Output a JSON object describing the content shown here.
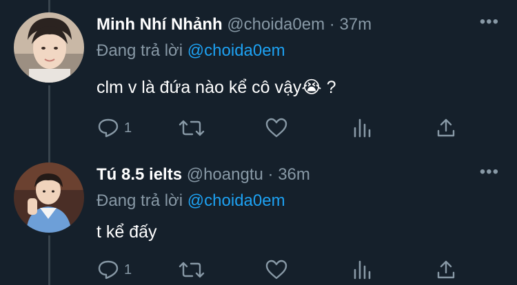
{
  "tweets": [
    {
      "name": "Minh Nhí Nhảnh",
      "handle": "@choida0em",
      "time": "37m",
      "reply_prefix": "Đang trả lời",
      "reply_to": "@choida0em",
      "text": "clm v là đứa nào kể cô vậy😭 ?",
      "reply_count": "1",
      "separator": "·",
      "more": "•••"
    },
    {
      "name": "Tú 8.5 ielts",
      "handle": "@hoangtu",
      "time": "36m",
      "reply_prefix": "Đang trả lời",
      "reply_to": "@choida0em",
      "text": "t kể đấy",
      "reply_count": "1",
      "separator": "·",
      "more": "•••"
    }
  ],
  "icons": {
    "reply": "reply-icon",
    "retweet": "retweet-icon",
    "like": "like-icon",
    "analytics": "analytics-icon",
    "share": "share-icon",
    "more": "more-icon"
  },
  "colors": {
    "background": "#15202b",
    "text": "#ffffff",
    "muted": "#8899a6",
    "accent": "#1da1f2",
    "thread_line": "#38444d"
  }
}
